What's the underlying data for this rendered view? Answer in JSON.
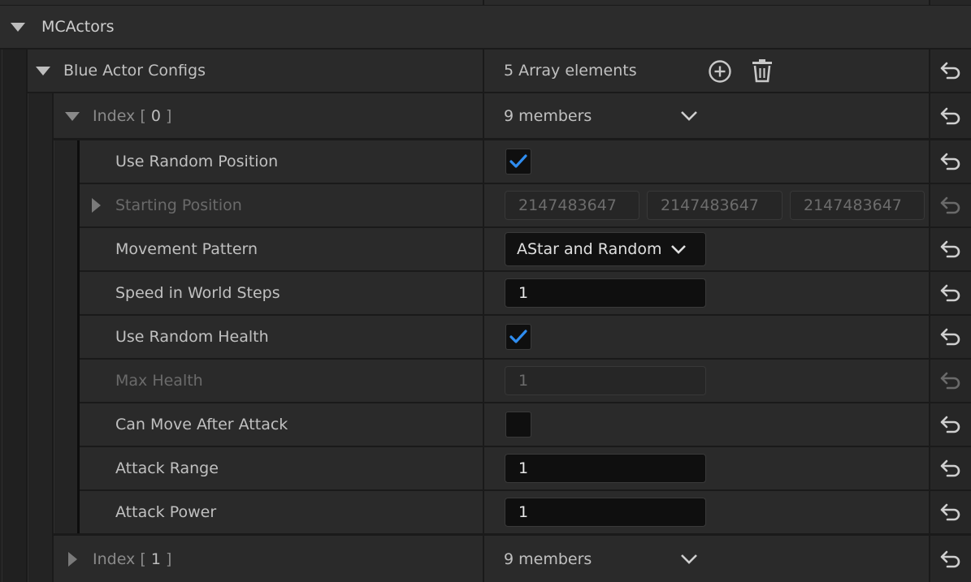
{
  "category": {
    "label": "MCActors"
  },
  "array": {
    "label": "Blue Actor Configs",
    "summary": "5 Array elements",
    "add_icon": "plus-circle-icon",
    "delete_icon": "trash-icon"
  },
  "index0": {
    "label_prefix": "Index [",
    "index": "0",
    "label_suffix": "]",
    "summary": "9 members"
  },
  "props": {
    "use_random_position": {
      "label": "Use Random Position",
      "checked": true
    },
    "starting_position": {
      "label": "Starting Position",
      "x": "2147483647",
      "y": "2147483647",
      "z": "2147483647"
    },
    "movement_pattern": {
      "label": "Movement Pattern",
      "value": "AStar and Random"
    },
    "speed": {
      "label": "Speed in World Steps",
      "value": "1"
    },
    "use_random_health": {
      "label": "Use Random Health",
      "checked": true
    },
    "max_health": {
      "label": "Max Health",
      "value": "1"
    },
    "can_move_after_attack": {
      "label": "Can Move After Attack",
      "checked": false
    },
    "attack_range": {
      "label": "Attack Range",
      "value": "1"
    },
    "attack_power": {
      "label": "Attack Power",
      "value": "1"
    }
  },
  "index1": {
    "label_prefix": "Index [",
    "index": "1",
    "label_suffix": "]",
    "summary": "9 members"
  },
  "colors": {
    "background": "#1a1a1a",
    "panel": "#2a2a2a",
    "checkmark": "#2f8df0",
    "text": "#c0c0c0",
    "text_disabled": "#6a6a6a"
  }
}
